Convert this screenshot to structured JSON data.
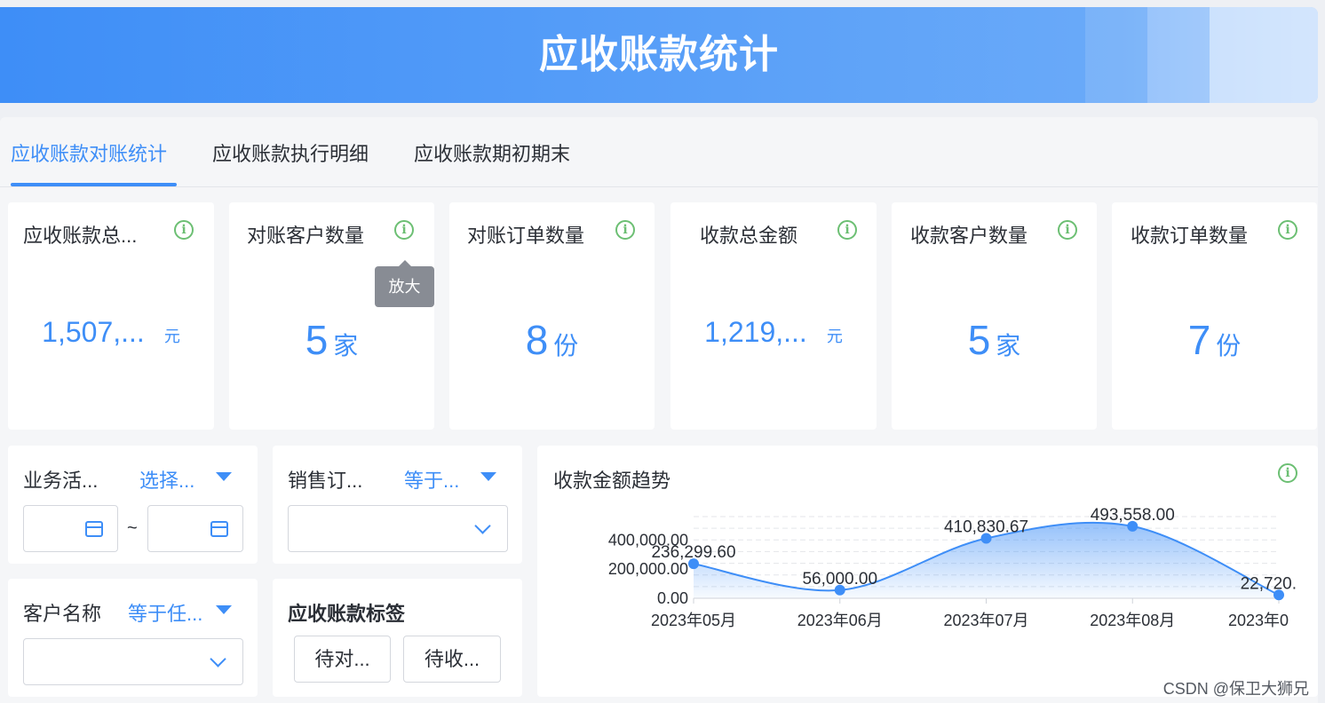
{
  "page_title": "应收账款统计",
  "tabs": [
    {
      "label": "应收账款对账统计",
      "active": true
    },
    {
      "label": "应收账款执行明细",
      "active": false
    },
    {
      "label": "应收账款期初期末",
      "active": false
    }
  ],
  "kpis": [
    {
      "title": "应收账款总...",
      "value": "1,507,...",
      "unit": "元"
    },
    {
      "title": "对账客户数量",
      "value": "5",
      "unit": "家"
    },
    {
      "title": "对账订单数量",
      "value": "8",
      "unit": "份"
    },
    {
      "title": "收款总金额",
      "value": "1,219,...",
      "unit": "元"
    },
    {
      "title": "收款客户数量",
      "value": "5",
      "unit": "家"
    },
    {
      "title": "收款订单数量",
      "value": "7",
      "unit": "份"
    }
  ],
  "tooltip": "放大",
  "info_icon": "i",
  "filters": {
    "business": {
      "label": "业务活...",
      "operator": "选择...",
      "range_separator": "~"
    },
    "sales_order": {
      "label": "销售订...",
      "operator": "等于..."
    },
    "customer": {
      "label": "客户名称",
      "operator": "等于任..."
    },
    "tags": {
      "label": "应收账款标签",
      "buttons": [
        "待对...",
        "待收..."
      ]
    }
  },
  "colors": {
    "accent": "#3e8ef7",
    "info_green": "#6cbf73",
    "banner_start": "#3e8ef7"
  },
  "chart_data": {
    "type": "area",
    "title": "收款金额趋势",
    "categories": [
      "2023年05月",
      "2023年06月",
      "2023年07月",
      "2023年08月",
      "2023年0"
    ],
    "values": [
      236299.6,
      56000.0,
      410830.67,
      493558.0,
      22720
    ],
    "point_labels": [
      "236,299.60",
      "56,000.00",
      "410,830.67",
      "493,558.00",
      "22,720."
    ],
    "y_ticks": [
      "400,000.00",
      "200,000.00",
      "0.00"
    ],
    "y_tick_values": [
      400000,
      200000,
      0
    ],
    "ylim": [
      0,
      560000
    ],
    "grid": true,
    "color": "#3e8ef7"
  },
  "watermark": "CSDN @保卫大狮兄"
}
